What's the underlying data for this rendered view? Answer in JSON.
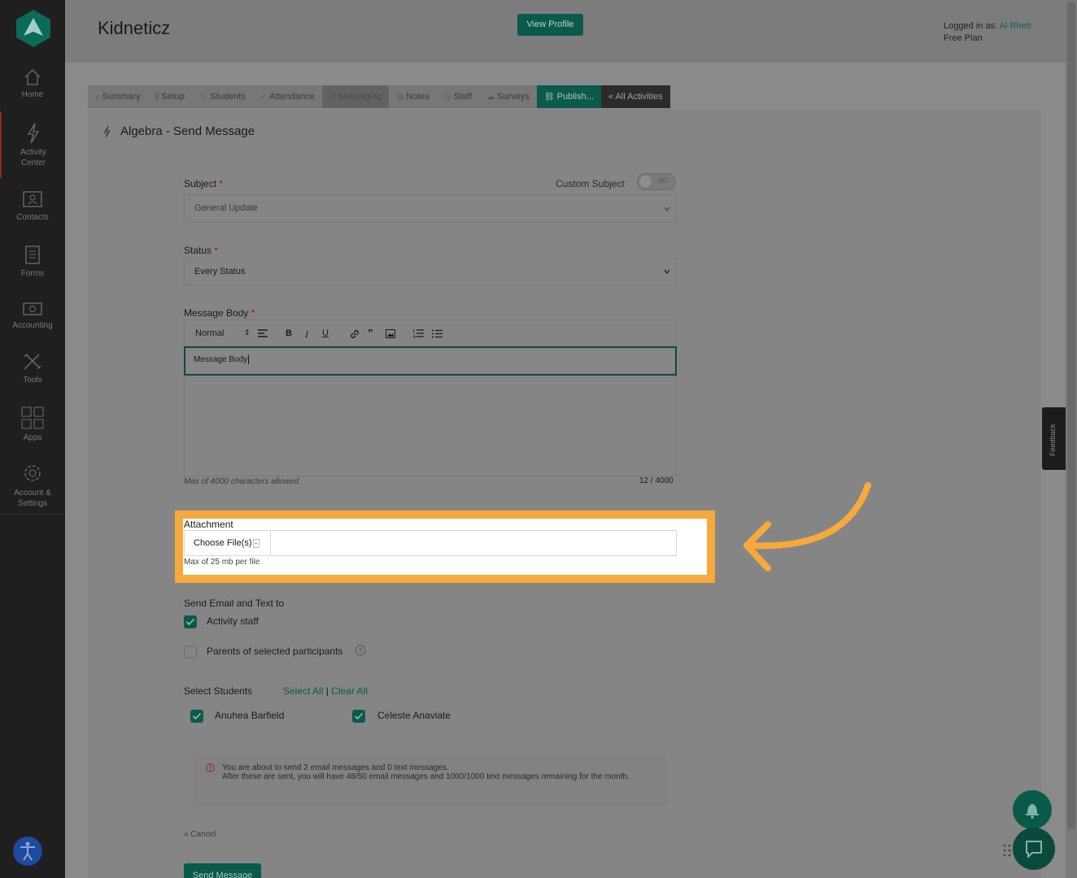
{
  "app": {
    "brand": "Kidneticz",
    "view_profile": "View Profile",
    "logged_prefix": "Logged in as:",
    "user": "Al Rhett",
    "plan": "Free Plan"
  },
  "sidebar": {
    "items": [
      {
        "label": "Home",
        "icon": "home-icon"
      },
      {
        "label": "Activity",
        "label2": "Center",
        "icon": "bolt-icon"
      },
      {
        "label": "Contacts",
        "icon": "contacts-icon"
      },
      {
        "label": "Forms",
        "icon": "forms-icon"
      },
      {
        "label": "Accounting",
        "icon": "money-icon"
      },
      {
        "label": "Tools",
        "icon": "tools-icon"
      },
      {
        "label": "Apps",
        "icon": "apps-icon"
      },
      {
        "label": "Account &",
        "label2": "Settings",
        "icon": "gear-icon"
      }
    ]
  },
  "tabs": [
    {
      "label": "Summary",
      "glyph": "⌕"
    },
    {
      "label": "Setup",
      "glyph": "⫼"
    },
    {
      "label": "Students",
      "glyph": "☺"
    },
    {
      "label": "Attendance",
      "glyph": "✓"
    },
    {
      "label": "Messaging",
      "glyph": "✉"
    },
    {
      "label": "Notes",
      "glyph": "◎"
    },
    {
      "label": "Staff",
      "glyph": "⚇"
    },
    {
      "label": "Surveys",
      "glyph": "☁"
    },
    {
      "label": "Publish...",
      "glyph": "⛓"
    },
    {
      "label": "« All Activities",
      "glyph": ""
    }
  ],
  "page": {
    "title": "Algebra - Send Message"
  },
  "form": {
    "subject_label": "Subject",
    "required_mark": "*",
    "custom_subject_label": "Custom Subject",
    "toggle_text": "NO",
    "subject_value": "General Update",
    "status_label": "Status",
    "status_value": "Every Status",
    "body_label": "Message Body",
    "format_value": "Normal",
    "body_value": "Message Body",
    "max_chars_note": "Max of 4000 characters allowed",
    "char_count": "12 / 4000",
    "attachment_label": "Attachment",
    "choose_files": "Choose File(s)",
    "attachment_note": "Max of 25 mb per file",
    "send_to_label": "Send Email and Text to",
    "opt_staff": "Activity staff",
    "opt_parents": "Parents of selected participants",
    "select_students_label": "Select Students",
    "select_all": "Select All",
    "separator": "|",
    "clear_all": "Clear All",
    "students": [
      "Anuhea Barfield",
      "Celeste Anaviate"
    ],
    "info_line1": "You are about to send 2 email messages and 0 text messages.",
    "info_line2": "After these are sent, you will have 48/50 email messages and 1000/1000 text messages remaining for the month.",
    "cancel": "« Cancel",
    "send": "Send Message"
  },
  "widgets": {
    "feedback": "Feedback"
  },
  "colors": {
    "accent": "#0b5a4b",
    "highlight": "#f7a93b",
    "required": "#8b1a1a"
  }
}
